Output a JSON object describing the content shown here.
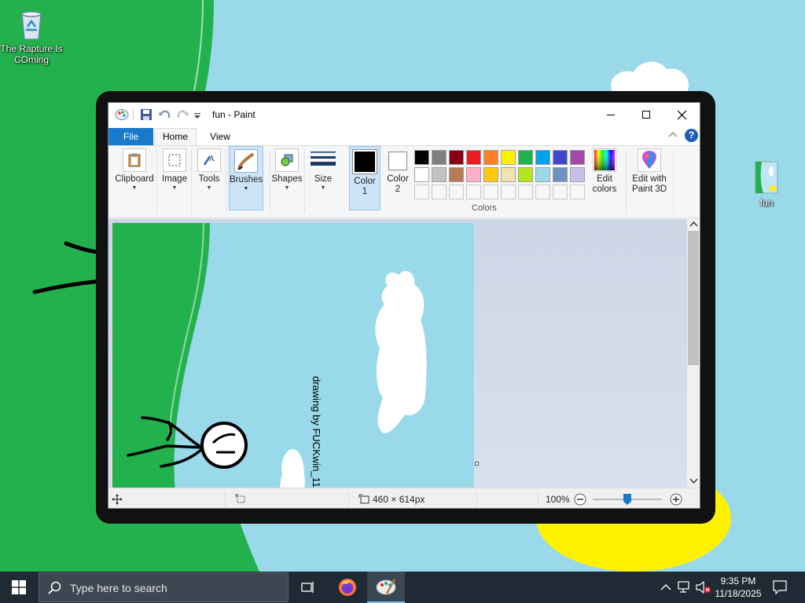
{
  "desktop": {
    "icons": [
      {
        "label_line1": "The Rapture Is",
        "label_line2": "COming",
        "icon": "recycle-bin-icon"
      },
      {
        "label_line1": "fun",
        "icon": "image-file-icon"
      }
    ]
  },
  "paint": {
    "title": "fun - Paint",
    "tabs": {
      "file": "File",
      "home": "Home",
      "view": "View"
    },
    "ribbon": {
      "clipboard": "Clipboard",
      "image": "Image",
      "tools": "Tools",
      "brushes": "Brushes",
      "shapes": "Shapes",
      "size": "Size",
      "color1_a": "Color",
      "color1_b": "1",
      "color2_a": "Color",
      "color2_b": "2",
      "edit_colors_a": "Edit",
      "edit_colors_b": "colors",
      "paint3d_a": "Edit with",
      "paint3d_b": "Paint 3D",
      "colors_group": "Colors",
      "help": "?"
    },
    "palette_row1": [
      "#000000",
      "#7f7f7f",
      "#880015",
      "#ed1c24",
      "#ff7f27",
      "#fff200",
      "#22b14c",
      "#00a2e8",
      "#3f48cc",
      "#a349a4"
    ],
    "palette_row2": [
      "#ffffff",
      "#c3c3c3",
      "#b97a57",
      "#ffaec9",
      "#ffc90e",
      "#efe4b0",
      "#b5e61d",
      "#99d9ea",
      "#7092be",
      "#c8bfe7"
    ],
    "color1": "#000000",
    "color2": "#ffffff",
    "canvas_text": "drawing by FUCKwin_11",
    "status": {
      "image_size": "460 × 614px",
      "zoom": "100%",
      "zoom_level_fraction": 0.5
    }
  },
  "taskbar": {
    "search_placeholder": "Type here to search",
    "time": "9:35 PM",
    "date": "11/18/2025"
  }
}
